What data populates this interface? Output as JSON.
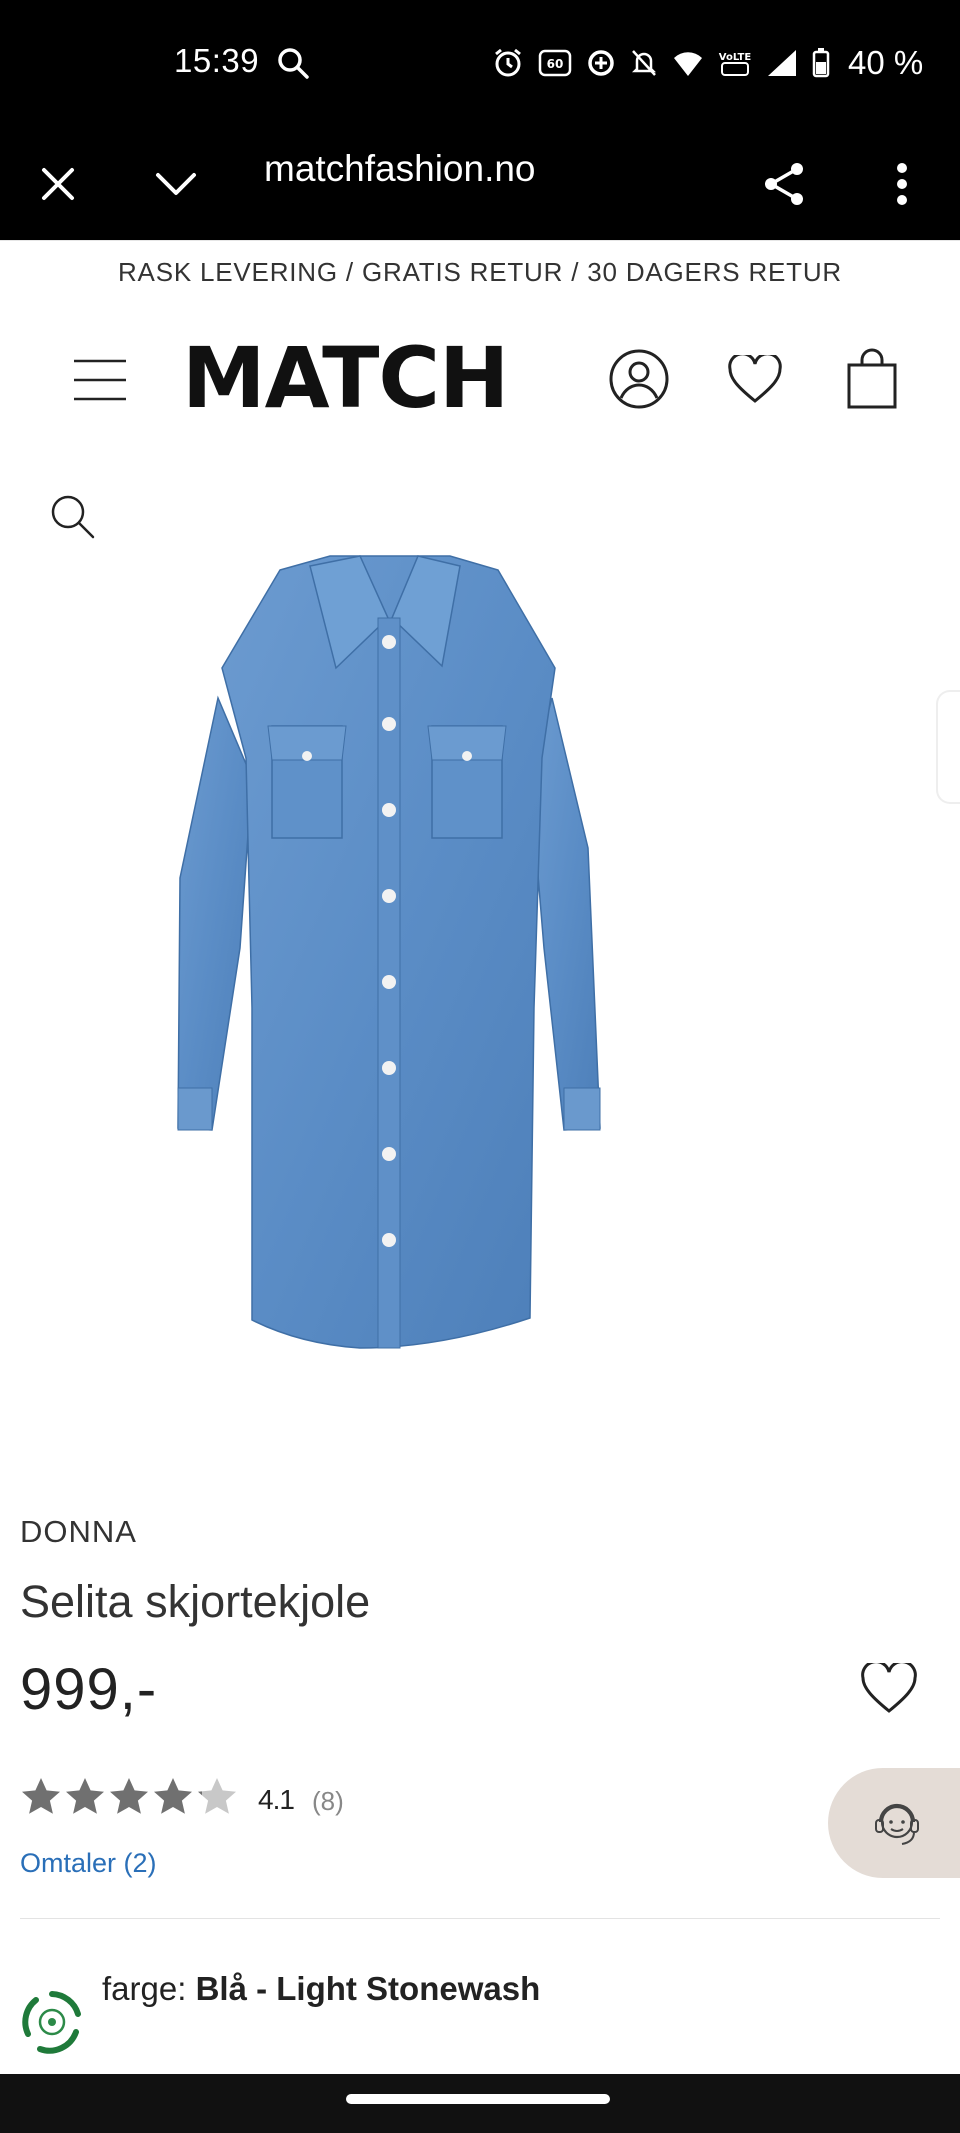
{
  "status_bar": {
    "time": "15:39",
    "battery": "40 %"
  },
  "browser": {
    "url": "matchfashion.no",
    "icons": [
      "close-icon",
      "chevron-down-icon",
      "share-icon",
      "more-vert-icon"
    ]
  },
  "promo": {
    "text": "RASK LEVERING / GRATIS RETUR / 30 DAGERS RETUR"
  },
  "header": {
    "logo": "MATCH",
    "icons": [
      "menu-icon",
      "account-icon",
      "heart-icon",
      "bag-icon"
    ]
  },
  "product": {
    "brand": "DONNA",
    "name": "Selita skjortekjole",
    "price": "999,-",
    "rating_value": "4.1",
    "rating_count": "(8)",
    "rating": 4.1,
    "reviews_link": "Omtaler (2)",
    "color_label": "farge:",
    "color_value": "Blå - Light Stonewash"
  },
  "colors": {
    "denim": "#5b8dc6",
    "link": "#2a6fb8",
    "star": "#707070",
    "chat_bg": "#e4dcd6",
    "eco_green": "#1f7a3a"
  }
}
